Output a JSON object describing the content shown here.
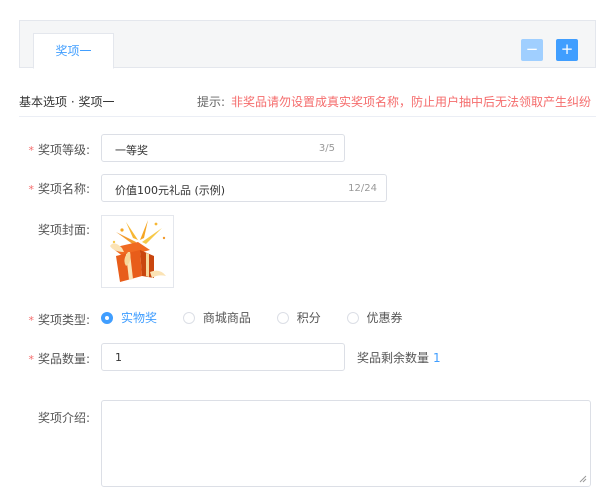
{
  "tabs": {
    "items": [
      {
        "label": "奖项一",
        "active": true
      }
    ],
    "minus_label": "−",
    "plus_label": "+"
  },
  "section": {
    "breadcrumb": "基本选项 · 奖项一",
    "hint_label": "提示:",
    "hint_text": "非奖品请勿设置成真实奖项名称，防止用户抽中后无法领取产生纠纷"
  },
  "form": {
    "level": {
      "label": "奖项等级:",
      "required": "*",
      "value": "一等奖",
      "counter": "3/5"
    },
    "name": {
      "label": "奖项名称:",
      "required": "*",
      "value": "价值100元礼品 (示例)",
      "counter": "12/24"
    },
    "cover": {
      "label": "奖项封面:"
    },
    "type": {
      "label": "奖项类型:",
      "required": "*",
      "options": [
        {
          "label": "实物奖",
          "checked": true
        },
        {
          "label": "商城商品",
          "checked": false
        },
        {
          "label": "积分",
          "checked": false
        },
        {
          "label": "优惠券",
          "checked": false
        }
      ]
    },
    "quantity": {
      "label": "奖品数量:",
      "required": "*",
      "value": "1",
      "remain_label": "奖品剩余数量",
      "remain_value": "1"
    },
    "intro": {
      "label": "奖项介绍:",
      "value": ""
    }
  },
  "colors": {
    "primary": "#409eff",
    "primary_light": "#a0cfff",
    "danger": "#f56c6c",
    "border": "#dcdfe6"
  }
}
